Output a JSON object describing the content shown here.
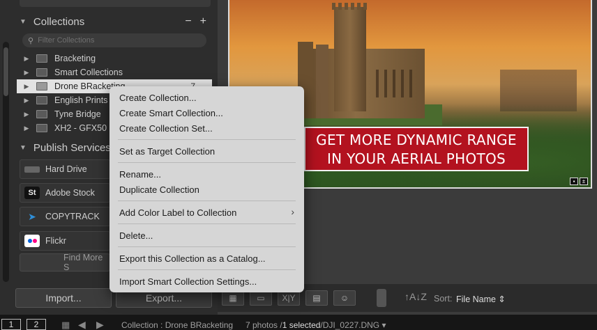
{
  "left_panel": {
    "collections_header": {
      "title": "Collections",
      "minus": "−",
      "plus": "+"
    },
    "filter_placeholder": "Filter Collections",
    "collections": [
      {
        "name": "Bracketing",
        "arrow": "▶",
        "count": ""
      },
      {
        "name": "Smart Collections",
        "arrow": "▶",
        "count": ""
      },
      {
        "name": "Drone BRacketing",
        "arrow": "▶",
        "count": "7",
        "selected": true
      },
      {
        "name": "English Prints",
        "arrow": "▶",
        "count": ""
      },
      {
        "name": "Tyne Bridge",
        "arrow": "▶",
        "count": ""
      },
      {
        "name": "XH2 - GFX50",
        "arrow": "▶",
        "count": ""
      }
    ],
    "publish_header": {
      "title": "Publish Services"
    },
    "services": [
      {
        "name": "Hard Drive",
        "icon": "hard-drive-icon",
        "icon_text": ""
      },
      {
        "name": "Adobe Stock",
        "icon": "adobe-stock-icon",
        "icon_text": "St"
      },
      {
        "name": "COPYTRACK",
        "icon": "copytrack-icon",
        "icon_text": "➤"
      },
      {
        "name": "Flickr",
        "icon": "flickr-icon",
        "icon_text": ""
      }
    ],
    "find_more": "Find More S",
    "import_label": "Import...",
    "export_label": "Export..."
  },
  "photo": {
    "banner_line1": "GET MORE DYNAMIC RANGE",
    "banner_line2": "IN YOUR AERIAL PHOTOS"
  },
  "toolbar": {
    "compare_icon": "X|Y",
    "sort_dir_icon": "↑A↓Z",
    "sort_label": "Sort:",
    "sort_value": "File Name ⇕"
  },
  "filmstrip": {
    "monitor1": "1",
    "monitor2": "2",
    "collection_text": "Collection : Drone BRacketing",
    "count_text": "7 photos /",
    "selected_text": "1 selected",
    "file_text": "/DJI_0227.DNG ▾"
  },
  "context_menu": {
    "items": [
      "Create Collection...",
      "Create Smart Collection...",
      "Create Collection Set...",
      "Set as Target Collection",
      "Rename...",
      "Duplicate Collection",
      "Add Color Label to Collection",
      "Delete...",
      "Export this Collection as a Catalog...",
      "Import Smart Collection Settings..."
    ],
    "submenu_arrow": "›"
  },
  "colors": {
    "banner_red": "#b3121f",
    "menu_bg": "#d6d6d6",
    "selected_row": "#e2e2e2"
  }
}
